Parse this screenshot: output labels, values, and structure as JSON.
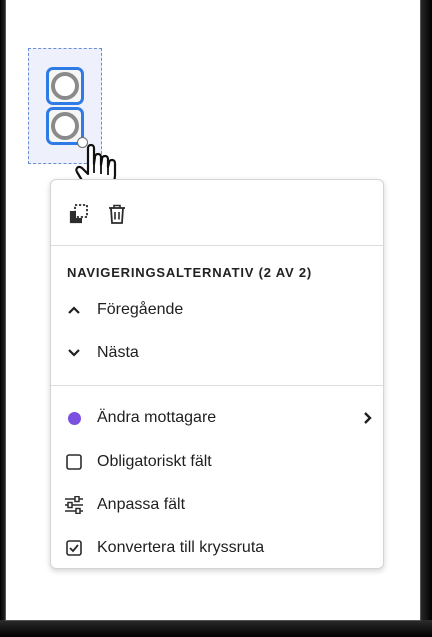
{
  "colors": {
    "selection_border": "#2e7be6",
    "recipient_dot": "#7b4fe0"
  },
  "toolbar": {
    "icons": [
      "duplicate-icon",
      "trash-icon"
    ]
  },
  "menu": {
    "section_heading": "NAVIGERINGSALTERNATIV (2 AV 2)",
    "items": [
      {
        "label": "Föregående",
        "icon": "chevron-up-icon"
      },
      {
        "label": "Nästa",
        "icon": "chevron-down-icon"
      },
      {
        "label": "Ändra mottagare",
        "icon": "recipient-dot-icon",
        "has_submenu": true
      },
      {
        "label": "Obligatoriskt fält",
        "icon": "checkbox-empty-icon"
      },
      {
        "label": "Anpassa fält",
        "icon": "sliders-icon"
      },
      {
        "label": "Konvertera till kryssruta",
        "icon": "checkbox-checked-icon"
      }
    ]
  }
}
